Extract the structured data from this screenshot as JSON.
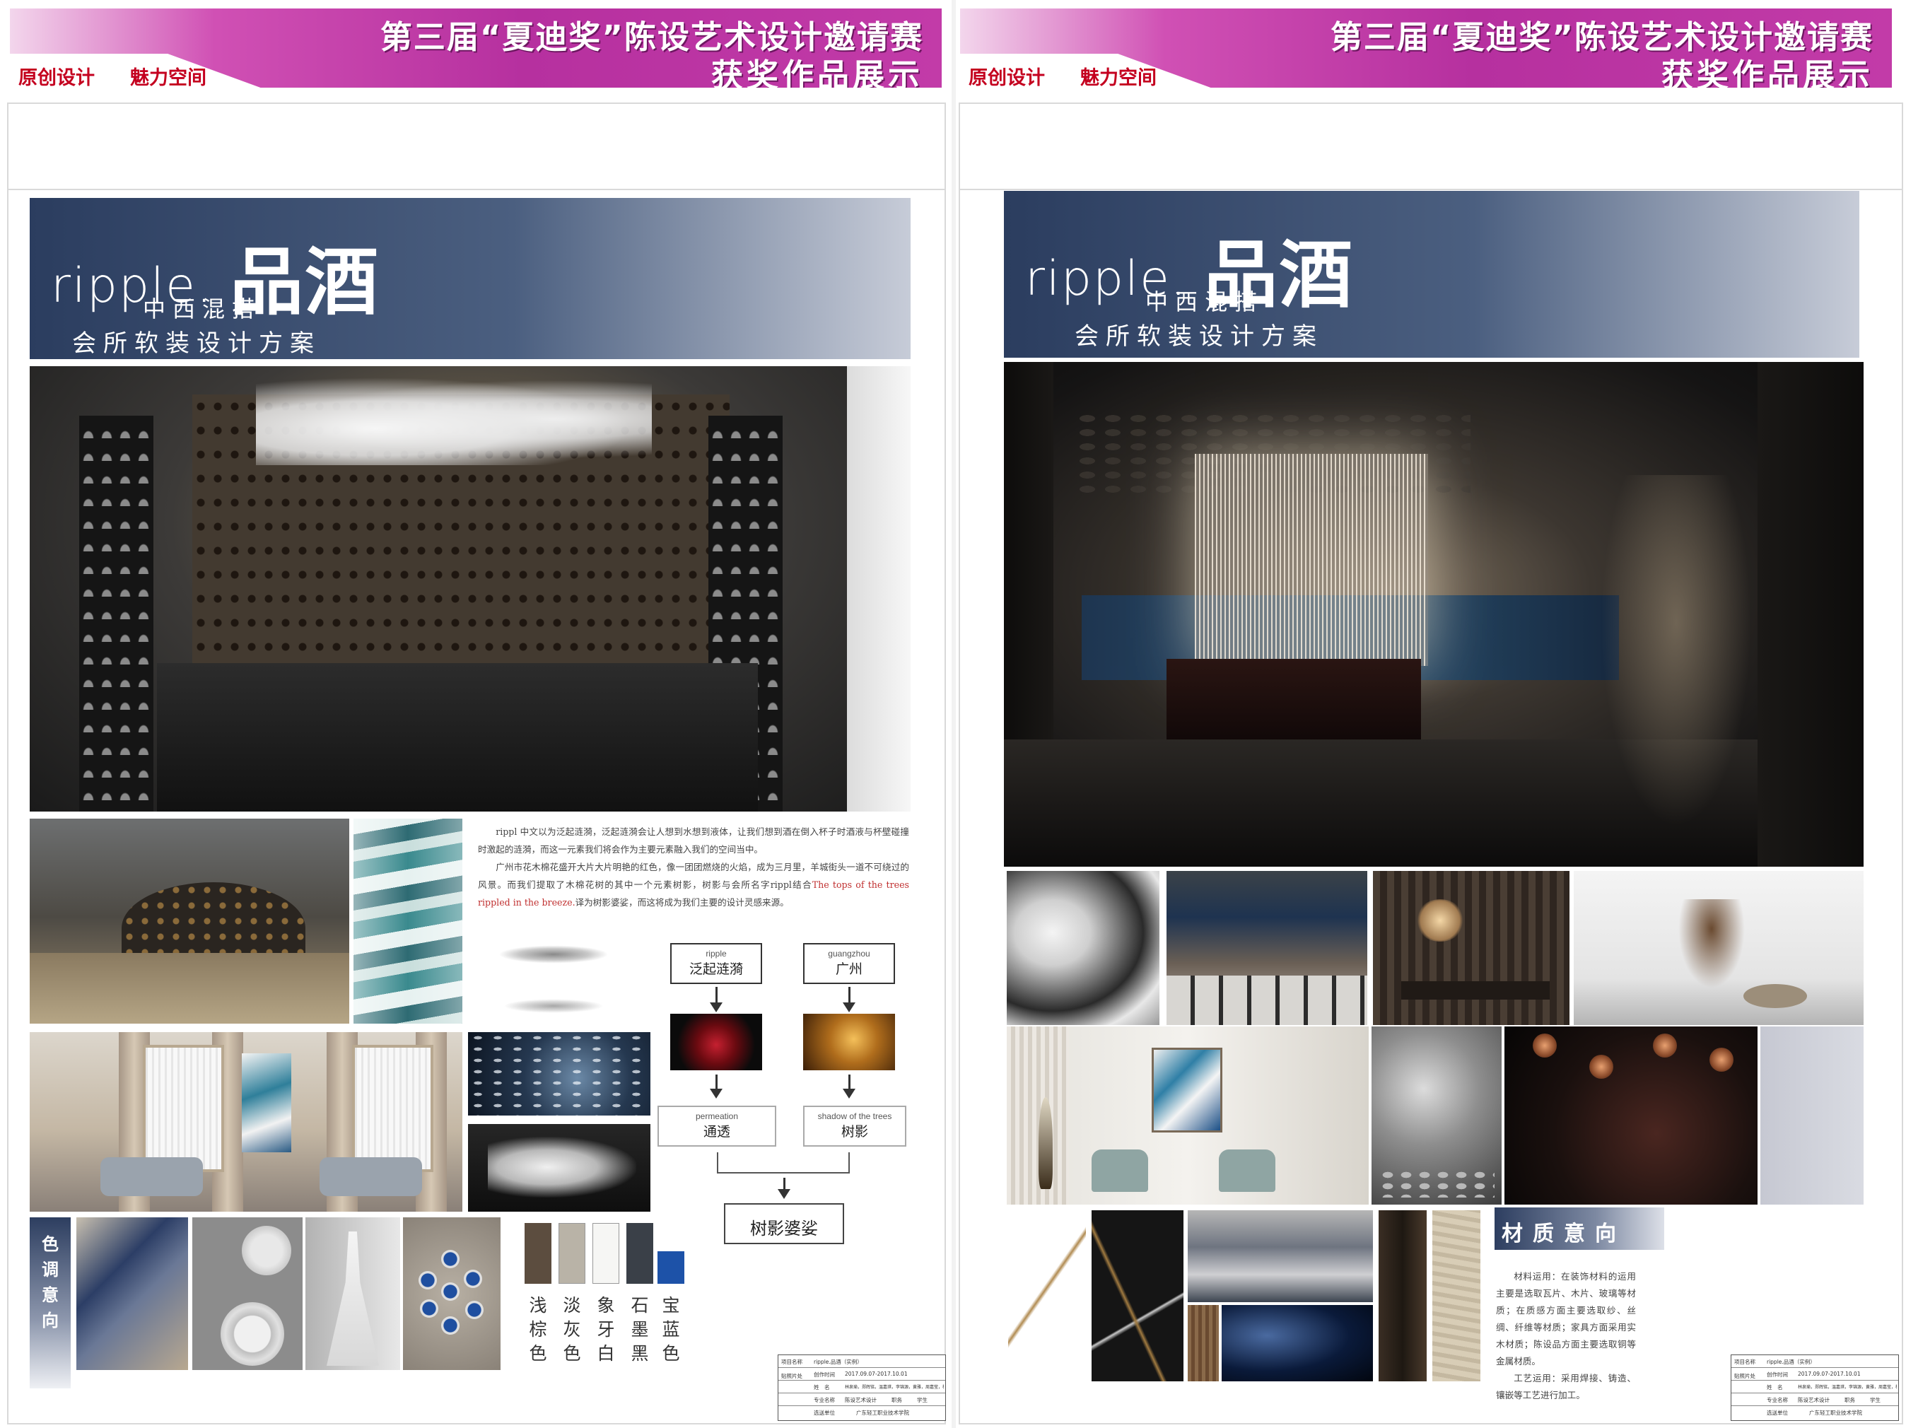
{
  "header": {
    "title_line1": "第三届“夏迪奖”陈设艺术设计邀请赛",
    "title_line2": "获奖作品展示",
    "tag1": "原创设计",
    "tag2": "魅力空间"
  },
  "board": {
    "title_en": "ripple.",
    "title_zh": "品酒",
    "subtitle1": "中西混搭",
    "subtitle2": "会所软装设计方案"
  },
  "left_page": {
    "description_p1": "rippl 中文以为泛起涟漪，泛起涟漪会让人想到水想到液体，让我们想到酒在倒入杯子时酒液与杯壁碰撞时激起的涟漪，而这一元素我们将会作为主要元素融入我们的空间当中。",
    "description_p2_a": "广州市花木棉花盛开大片大片明艳的红色，像一团团燃烧的火焰，成为三月里，羊城街头一道不可绕过的风景。而我们提取了木棉花树的其中一个元素树影，树影与会所名字rippl结合",
    "description_p2_red": "The tops of the trees rippled in the breeze.",
    "description_p2_b": "译为树影婆娑，而这将成为我们主要的设计灵感来源。",
    "color_section_label": "色调意向",
    "swatches": [
      {
        "name": "浅棕色",
        "color": "#5c4d3f"
      },
      {
        "name": "淡灰色",
        "color": "#b9b3a7"
      },
      {
        "name": "象牙白",
        "color": "#f6f6f4"
      },
      {
        "name": "石墨黑",
        "color": "#3a4048"
      },
      {
        "name": "宝蓝色",
        "color": "#1d52a8"
      }
    ],
    "flow": {
      "box1_en": "ripple",
      "box1_zh": "泛起涟漪",
      "box2_en": "guangzhou",
      "box2_zh": "广州",
      "box3_en": "permeation",
      "box3_zh": "通透",
      "box4_en": "shadow of the trees",
      "box4_zh": "树影",
      "result": "树影婆娑"
    }
  },
  "right_page": {
    "material_title": "材质意向",
    "material_p1": "材料运用：在装饰材料的运用主要是选取瓦片、木片、玻璃等材质；在质感方面主要选取纱、丝绸、纤维等材质；家具方面采用实木材质；陈设品方面主要选取铜等金属材质。",
    "material_p2": "工艺运用：采用焊接、铸造、镶嵌等工艺进行加工。"
  },
  "info_table": {
    "project_label": "项目名称",
    "project_value": "ripple.品酒（实例）",
    "time_label": "创作时间",
    "time_value": "2017.09.07-2017.10.01",
    "paste_label": "贴照片处",
    "name_label": "姓　名",
    "name_value": "林泉瑜，郑辉铭，温嘉琪，李锦源，黄雅，周嘉莹，杨文倩，陈世美",
    "major_label": "专业名称",
    "major_value": "陈设艺术设计",
    "duty_label": "职务",
    "duty_value": "学生",
    "unit_label": "选送单位",
    "unit_value": "广东轻工职业技术学院"
  }
}
